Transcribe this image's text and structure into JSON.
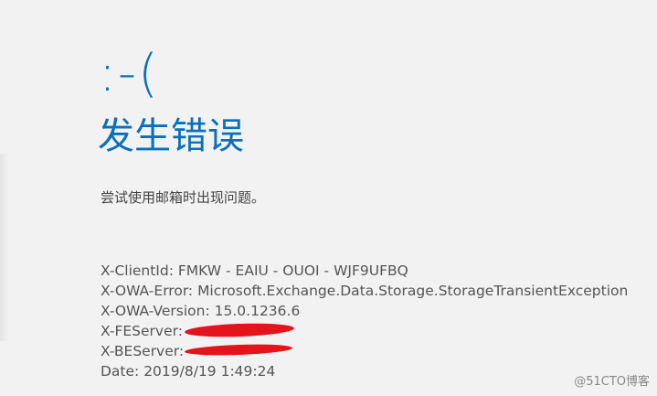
{
  "error": {
    "emoticon": ":-(",
    "title": "发生错误",
    "message": "尝试使用邮箱时出现问题。"
  },
  "details": {
    "client_id": "X-ClientId: FMKW - EAIU - OUOI - WJF9UFBQ",
    "owa_error": "X-OWA-Error: Microsoft.Exchange.Data.Storage.StorageTransientException",
    "owa_version": "X-OWA-Version: 15.0.1236.6",
    "fe_server_label": "X-FEServer:",
    "be_server_label": "X-BEServer:",
    "date": "Date: 2019/8/19 1:49:24"
  },
  "watermark": "@51CTO博客",
  "colors": {
    "accent": "#0a6fbc",
    "redaction": "#e4141c"
  }
}
